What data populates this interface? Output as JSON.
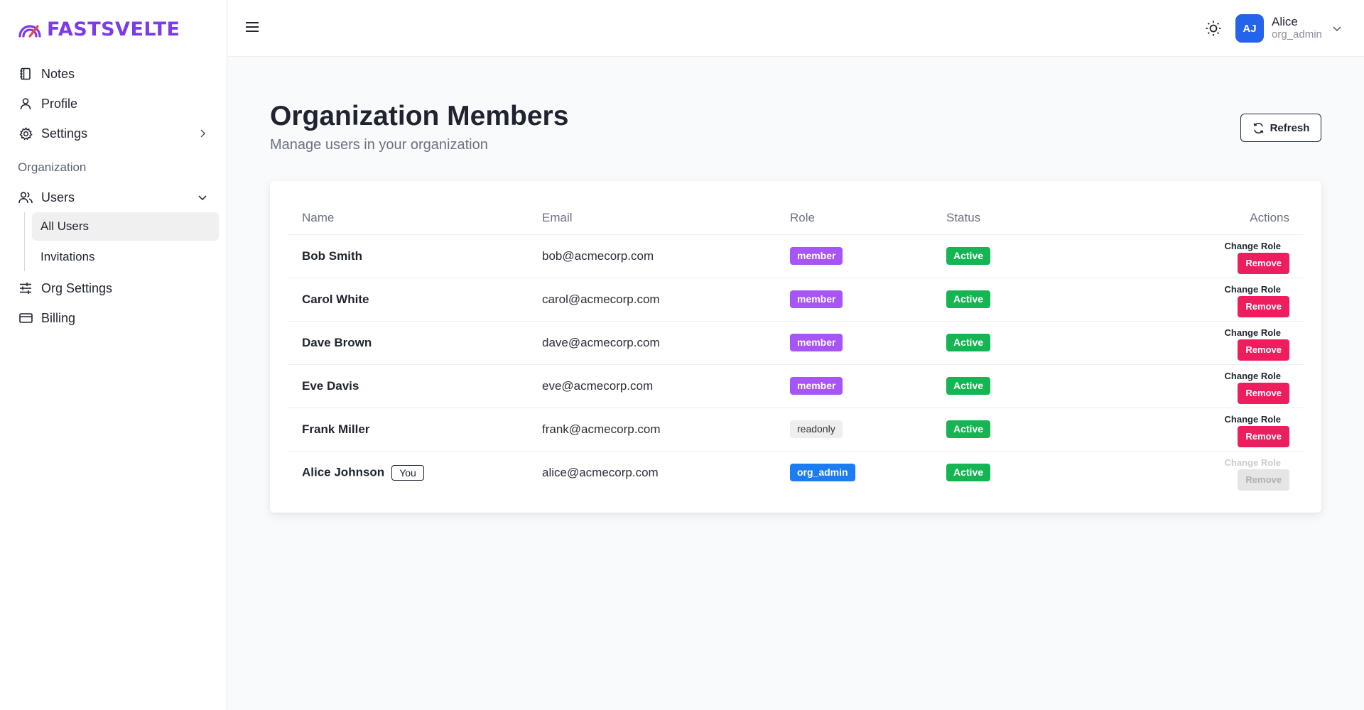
{
  "app": {
    "logo_text": "FASTSVELTE"
  },
  "sidebar": {
    "items": [
      {
        "label": "Notes",
        "icon": "notebook-icon"
      },
      {
        "label": "Profile",
        "icon": "user-icon"
      },
      {
        "label": "Settings",
        "icon": "gear-icon"
      }
    ],
    "section_label": "Organization",
    "users": {
      "label": "Users",
      "icon": "users-icon"
    },
    "sub_items": [
      {
        "label": "All Users",
        "active": true
      },
      {
        "label": "Invitations",
        "active": false
      }
    ],
    "org_items": [
      {
        "label": "Org Settings",
        "icon": "sliders-icon"
      },
      {
        "label": "Billing",
        "icon": "credit-card-icon"
      }
    ]
  },
  "header": {
    "user": {
      "initials": "AJ",
      "name": "Alice",
      "role": "org_admin"
    }
  },
  "main": {
    "title": "Organization Members",
    "subtitle": "Manage users in your organization",
    "refresh_label": "Refresh",
    "table": {
      "headers": [
        "Name",
        "Email",
        "Role",
        "Status",
        "Actions"
      ],
      "rows": [
        {
          "name": "Bob Smith",
          "email": "bob@acmecorp.com",
          "role": "member",
          "status": "Active",
          "change_role": "Change Role",
          "remove": "Remove"
        },
        {
          "name": "Carol White",
          "email": "carol@acmecorp.com",
          "role": "member",
          "status": "Active",
          "change_role": "Change Role",
          "remove": "Remove"
        },
        {
          "name": "Dave Brown",
          "email": "dave@acmecorp.com",
          "role": "member",
          "status": "Active",
          "change_role": "Change Role",
          "remove": "Remove"
        },
        {
          "name": "Eve Davis",
          "email": "eve@acmecorp.com",
          "role": "member",
          "status": "Active",
          "change_role": "Change Role",
          "remove": "Remove"
        },
        {
          "name": "Frank Miller",
          "email": "frank@acmecorp.com",
          "role": "readonly",
          "status": "Active",
          "change_role": "Change Role",
          "remove": "Remove"
        },
        {
          "name": "Alice Johnson",
          "you": "You",
          "email": "alice@acmecorp.com",
          "role": "org_admin",
          "status": "Active",
          "change_role": "Change Role",
          "remove": "Remove"
        }
      ]
    }
  },
  "colors": {
    "brand": "#7c3aed",
    "member": "#a855f7",
    "org_admin": "#1d7cf2",
    "active": "#16b553",
    "remove": "#ee1d5e"
  }
}
